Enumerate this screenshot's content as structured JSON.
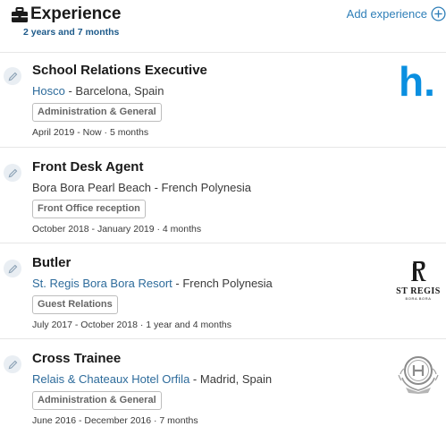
{
  "header": {
    "title": "Experience",
    "duration": "2 years and 7 months",
    "add_label": "Add experience"
  },
  "experiences": [
    {
      "role": "School Relations Executive",
      "company": "Hosco",
      "location": " - Barcelona, Spain",
      "tag": "Administration & General",
      "dates": "April 2019 - Now · 5 months",
      "logo_text": "h."
    },
    {
      "role": "Front Desk Agent",
      "company": "Bora Bora Pearl Beach",
      "location": " - French Polynesia",
      "tag": "Front Office reception",
      "dates": "October 2018 - January 2019 · 4 months"
    },
    {
      "role": "Butler",
      "company": "St. Regis Bora Bora Resort",
      "location": " - French Polynesia",
      "tag": "Guest Relations",
      "dates": "July 2017 - October 2018 · 1 year and 4 months",
      "logo_text": "ST REGIS",
      "logo_subtext": "BORA BORA"
    },
    {
      "role": "Cross Trainee",
      "company": "Relais & Chateaux Hotel Orfila",
      "location": " - Madrid, Spain",
      "tag": "Administration & General",
      "dates": "June 2016 - December 2016 · 7 months"
    }
  ],
  "colors": {
    "accent": "#2f7fb8",
    "company_link": "#2d6b9b",
    "subtitle": "#1d5a8a",
    "hosco_brand": "#0a8fe0"
  },
  "icons": [
    "briefcase-icon",
    "add-circle-icon",
    "pencil-icon"
  ]
}
